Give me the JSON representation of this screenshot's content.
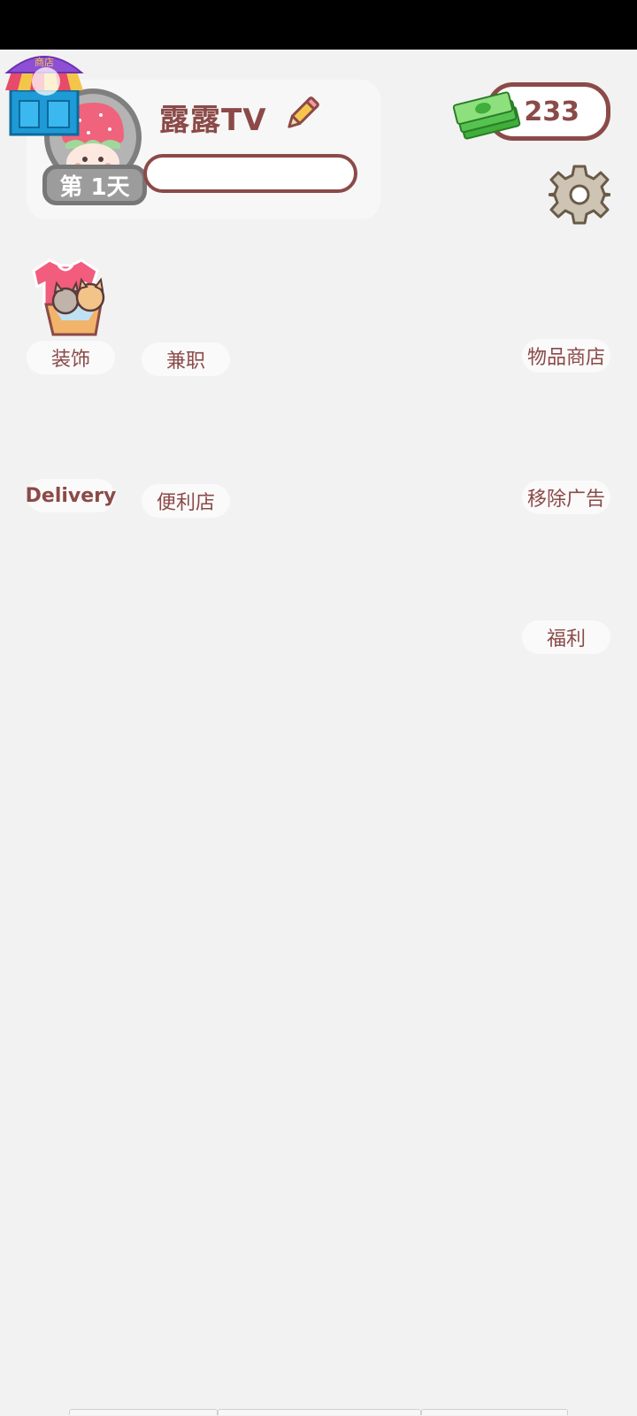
{
  "profile": {
    "username": "露露TV",
    "day_label": "第 1天"
  },
  "currency": {
    "amount": "233"
  },
  "shop": {
    "label": "商店"
  },
  "menu_left": [
    {
      "label": "装饰"
    },
    {
      "label": "兼职"
    },
    {
      "label": "Delivery"
    },
    {
      "label": "便利店"
    }
  ],
  "menu_right": [
    {
      "label": "物品商店"
    },
    {
      "label": "移除广告"
    },
    {
      "label": "福利"
    }
  ],
  "colors": {
    "accent": "#8b4a48",
    "background": "#f2f2f2",
    "pill": "#fafafa"
  }
}
